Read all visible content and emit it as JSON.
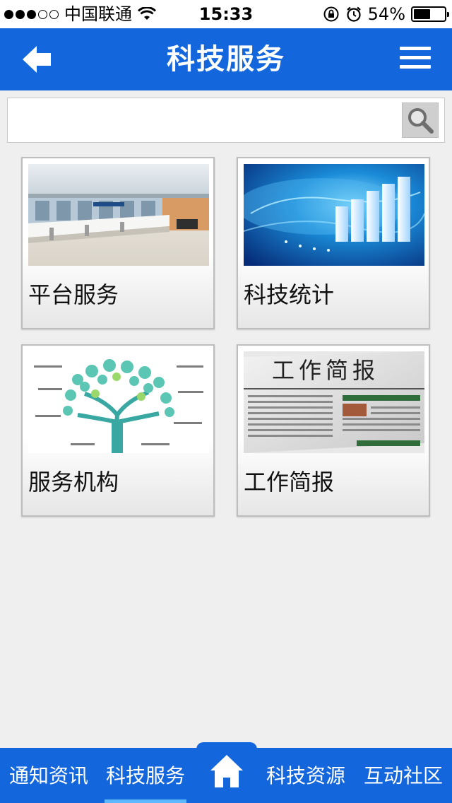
{
  "status_bar": {
    "carrier": "中国联通",
    "time": "15:33",
    "battery_text": "54%",
    "battery_level": 0.54,
    "signal_dots_filled": 3,
    "signal_dots_total": 5
  },
  "header": {
    "title": "科技服务",
    "back_icon": "arrow-left-icon",
    "menu_icon": "hamburger-menu-icon"
  },
  "search": {
    "value": "",
    "placeholder": "",
    "icon": "magnifier-icon"
  },
  "tiles": [
    {
      "label": "平台服务",
      "image": "service-hall-photo"
    },
    {
      "label": "科技统计",
      "image": "globe-bar-chart-graphic"
    },
    {
      "label": "服务机构",
      "image": "service-tree-diagram"
    },
    {
      "label": "工作简报",
      "image": "newspaper-graphic",
      "image_text": "工作简报"
    }
  ],
  "bottom_nav": {
    "items": [
      {
        "label": "通知资讯"
      },
      {
        "label": "科技服务",
        "active": true
      },
      {
        "label": "科技资源"
      },
      {
        "label": "互动社区"
      }
    ],
    "home_icon": "home-icon"
  },
  "colors": {
    "primary": "#1466dc",
    "background": "#efeff0",
    "active_indicator": "#5db8ff"
  }
}
